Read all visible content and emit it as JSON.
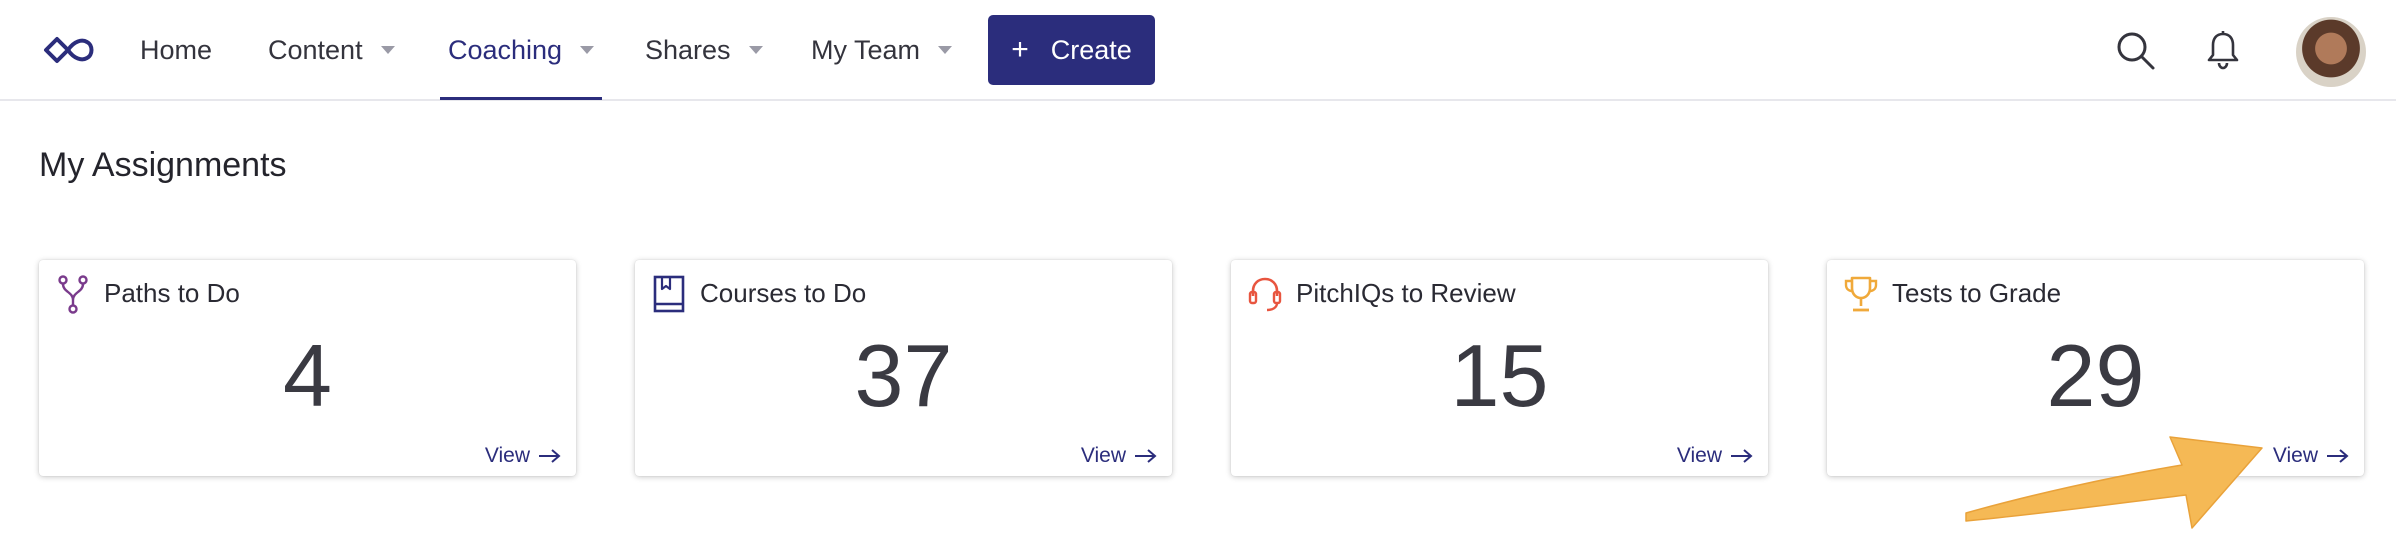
{
  "nav": {
    "logo_icon": "infinity-logo-icon",
    "items": [
      {
        "label": "Home"
      },
      {
        "label": "Content"
      },
      {
        "label": "Coaching"
      },
      {
        "label": "Shares"
      },
      {
        "label": "My Team"
      }
    ],
    "active": "Coaching",
    "create_label": "Create",
    "icons": [
      "search-icon",
      "bell-icon"
    ],
    "accent_color": "#2b2d7c"
  },
  "page": {
    "title": "My Assignments"
  },
  "cards": [
    {
      "title": "Paths to Do",
      "count": "4",
      "link": "View",
      "icon": "fork-path-icon",
      "icon_color": "#7a3b8c"
    },
    {
      "title": "Courses to Do",
      "count": "37",
      "link": "View",
      "icon": "book-icon",
      "icon_color": "#2b2d7c"
    },
    {
      "title": "PitchIQs to Review",
      "count": "15",
      "link": "View",
      "icon": "headset-icon",
      "icon_color": "#e8553f"
    },
    {
      "title": "Tests to Grade",
      "count": "29",
      "link": "View",
      "icon": "trophy-icon",
      "icon_color": "#f0a93a"
    }
  ],
  "annotation": {
    "icon": "pointer-arrow-icon",
    "color": "#f5b955"
  }
}
